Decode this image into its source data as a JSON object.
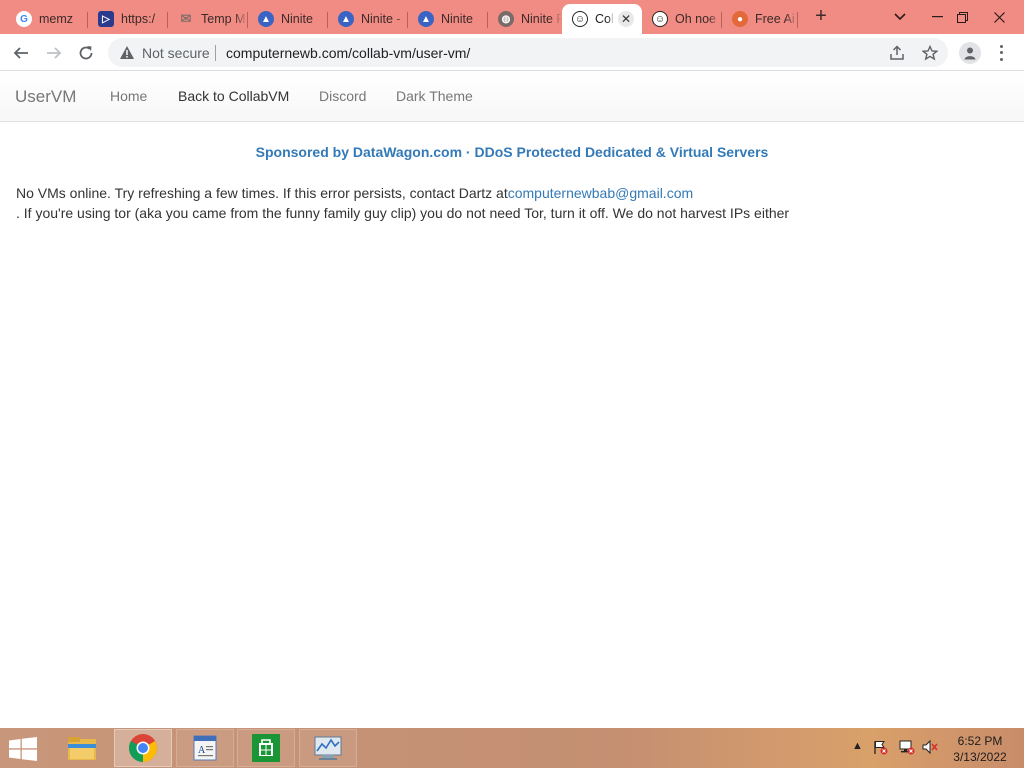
{
  "browser": {
    "tabs": [
      {
        "title": "memz",
        "icon": "google-icon"
      },
      {
        "title": "https:/",
        "icon": "play-icon"
      },
      {
        "title": "Temp M",
        "icon": "mail-icon"
      },
      {
        "title": "Ninite",
        "icon": "ninite-icon"
      },
      {
        "title": "Ninite -",
        "icon": "ninite-icon"
      },
      {
        "title": "Ninite",
        "icon": "ninite-icon"
      },
      {
        "title": "Ninite F",
        "icon": "globe-icon"
      },
      {
        "title": "Coll",
        "icon": "collabvm-icon",
        "active": true
      },
      {
        "title": "Oh noe",
        "icon": "collabvm-icon"
      },
      {
        "title": "Free Ai",
        "icon": "firefox-icon"
      }
    ],
    "security_label": "Not secure",
    "url": "computernewb.com/collab-vm/user-vm/"
  },
  "site": {
    "brand": "UserVM",
    "nav": [
      "Home",
      "Back to CollabVM",
      "Discord",
      "Dark Theme"
    ],
    "sponsor": "Sponsored by DataWagon.com · DDoS Protected Dedicated & Virtual Servers",
    "notice_line1": "No VMs online. Try refreshing a few times. If this error persists, contact Dartz at",
    "notice_email": "computernewbab@gmail.com",
    "notice_line2": ". If you're using tor (aka you came from the funny family guy clip) you do not need Tor, turn it off. We do not harvest IPs either"
  },
  "taskbar": {
    "time": "6:52 PM",
    "date": "3/13/2022"
  },
  "colors": {
    "tabstrip": "#f08c84",
    "link": "#337ab7",
    "taskbar": "#c8967a"
  }
}
